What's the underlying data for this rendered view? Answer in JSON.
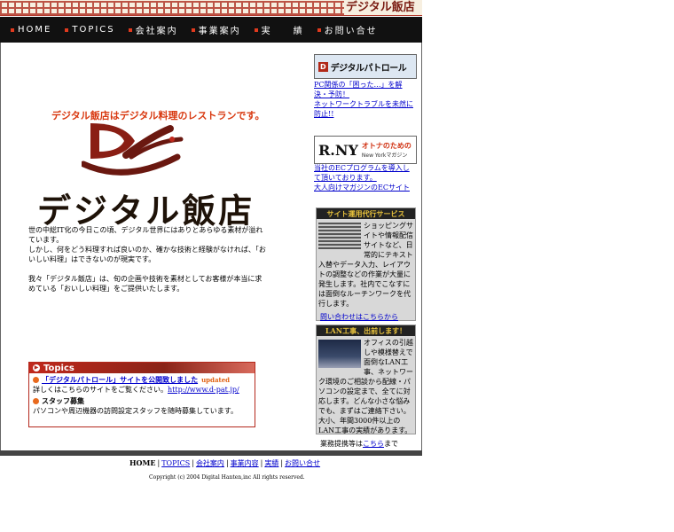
{
  "header": {
    "brand": "デジタル飯店"
  },
  "nav": {
    "items": [
      "HOME",
      "TOPICS",
      "会社案内",
      "事業案内",
      "実　　績",
      "お問い合せ"
    ]
  },
  "main": {
    "tagline": "デジタル飯店はデジタル料理のレストランです。",
    "logo_title": "デジタル飯店",
    "intro": [
      "世の中総IT化の今日この頃、デジタル世界にはありとあらゆる素材が溢れています。",
      "しかし、何をどう料理すれば良いのか、確かな技術と経験がなければ、「おいしい料理」はできないのが現実です。",
      "我々「デジタル飯店」は、旬の企画や技術を素材としてお客様が本当に求めている「おいしい料理」をご提供いたします。"
    ]
  },
  "topics": {
    "title": "Topics",
    "item1_link": "「デジタルパトロール」サイトを公開致しました",
    "item1_badge": "updated",
    "item1_detail": "詳しくはこちらのサイトをご覧ください。",
    "item1_url": "http://www.d-pat.jp/",
    "item2_title": "スタッフ募集",
    "item2_detail": "パソコンや周辺機器の訪問設定スタッフを随時募集しています。"
  },
  "sidebar": {
    "banner1_logo": "D",
    "banner1_text": "デジタルパトロール",
    "banner1_links": [
      "PC関係の「困った…」を解決・予防！",
      "ネットワークトラブルを未然に防止!!"
    ],
    "banner2_logo": "R.NY",
    "banner2_tag": "オトナのための",
    "banner2_sub": "New Yorkマガジン",
    "banner2_links": [
      "当社のECプログラムを導入して頂いております。",
      "大人向けマガジンのECサイト"
    ],
    "box1_title": "サイト運用代行サービス",
    "box1_text": "ショッピングサイトや情報配信サイトなど、日常的にテキスト入替やデータ入力、レイアウトの調整などの作業が大量に発生します。社内でこなすには面倒なルーチンワークを代行します。",
    "box1_link": "問い合わせはこちらから",
    "box2_title": "LAN工事、出前します！",
    "box2_text": "オフィスの引越しや模様替えで面倒なLAN工事、ネットワーク環境のご相談から配線・パソコンの設定まで、全てに対応します。どんな小さな悩みでも、まずはご連絡下さい。大小、年間3000件以上のLAN工事の実績があります。",
    "box2_foot_prefix": "業務提携等は",
    "box2_foot_link": "こちら",
    "box2_foot_suffix": "まで"
  },
  "footer": {
    "links": [
      "HOME",
      "TOPICS",
      "会社案内",
      "事業内容",
      "実績",
      "お問い合せ"
    ],
    "separator": "|",
    "copyright": "Copyright (c) 2004 Digital Hanten,inc All rights reserved."
  },
  "colors": {
    "accent": "#d8380f",
    "nav_bg": "#111111",
    "link": "#0000cc",
    "topics_red": "#b4281c"
  }
}
